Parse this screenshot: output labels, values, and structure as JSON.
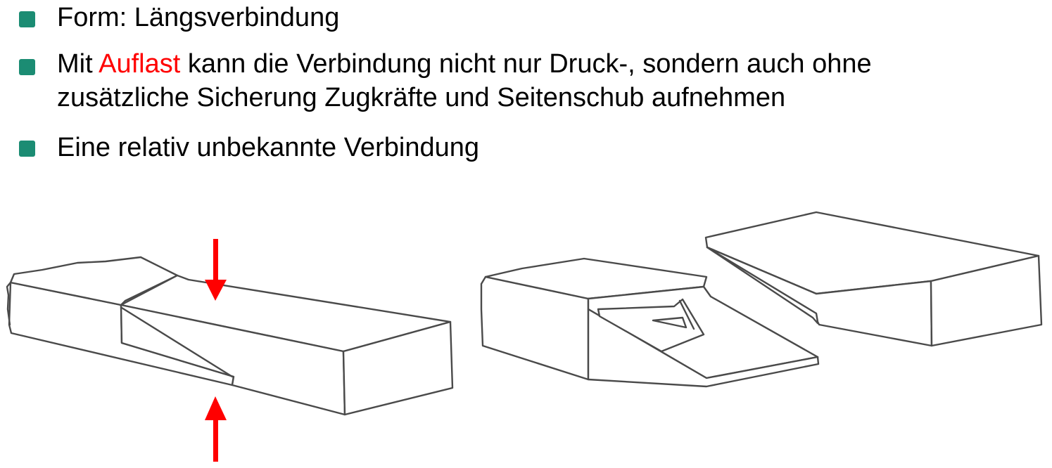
{
  "bullets": [
    {
      "text": "Form: Längsverbindung"
    },
    {
      "line1_before": "Mit ",
      "line1_highlight": "Auflast",
      "line1_after": " kann die Verbindung nicht nur Druck-, sondern auch ohne",
      "line2": "zusätzliche Sicherung Zugkräfte und Seitenschub aufnehmen"
    },
    {
      "text": "Eine relativ unbekannte Verbindung"
    }
  ],
  "colors": {
    "bullet_marker": "#1b8c73",
    "highlight": "#ff0000",
    "arrow": "#ff0000",
    "sketch_line": "#4a4a4a"
  },
  "figure": {
    "left_sketch": "assembled-joint",
    "right_sketch": "separated-joint",
    "force_arrows": [
      "down",
      "up"
    ]
  }
}
